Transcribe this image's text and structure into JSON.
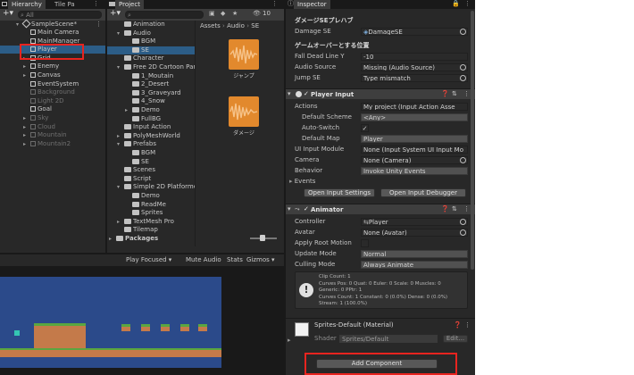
{
  "hierarchy": {
    "tab": "Hierarchy",
    "tab2": "Tile Pa",
    "search_placeholder": "All",
    "scene": "SampleScene*",
    "items": [
      {
        "label": "Main Camera",
        "dim": false,
        "arrow": ""
      },
      {
        "label": "MainManager",
        "dim": false,
        "arrow": ""
      },
      {
        "label": "Player",
        "dim": false,
        "arrow": "",
        "selected": true
      },
      {
        "label": "Grid",
        "dim": false,
        "arrow": "▸"
      },
      {
        "label": "Enemy",
        "dim": false,
        "arrow": "▸"
      },
      {
        "label": "Canvas",
        "dim": false,
        "arrow": "▸"
      },
      {
        "label": "EventSystem",
        "dim": false,
        "arrow": ""
      },
      {
        "label": "Background",
        "dim": true,
        "arrow": ""
      },
      {
        "label": "Light 2D",
        "dim": true,
        "arrow": ""
      },
      {
        "label": "Goal",
        "dim": false,
        "arrow": ""
      },
      {
        "label": "Sky",
        "dim": true,
        "arrow": "▸"
      },
      {
        "label": "Cloud",
        "dim": true,
        "arrow": "▸"
      },
      {
        "label": "Mountain",
        "dim": true,
        "arrow": "▸"
      },
      {
        "label": "Mountain2",
        "dim": true,
        "arrow": "▸"
      }
    ]
  },
  "project": {
    "tab": "Project",
    "badge": "10",
    "breadcrumb": {
      "a": "Assets",
      "b": "Audio",
      "c": "SE"
    },
    "tree": [
      {
        "label": "Animation",
        "indent": 1,
        "arrow": ""
      },
      {
        "label": "Audio",
        "indent": 1,
        "arrow": "▾"
      },
      {
        "label": "BGM",
        "indent": 2,
        "arrow": ""
      },
      {
        "label": "SE",
        "indent": 2,
        "arrow": "",
        "selected": true
      },
      {
        "label": "Character",
        "indent": 1,
        "arrow": ""
      },
      {
        "label": "Free 2D Cartoon Para",
        "indent": 1,
        "arrow": "▾"
      },
      {
        "label": "1_Moutain",
        "indent": 2,
        "arrow": ""
      },
      {
        "label": "2_Desert",
        "indent": 2,
        "arrow": ""
      },
      {
        "label": "3_Graveyard",
        "indent": 2,
        "arrow": ""
      },
      {
        "label": "4_Snow",
        "indent": 2,
        "arrow": ""
      },
      {
        "label": "Demo",
        "indent": 2,
        "arrow": "▸"
      },
      {
        "label": "FullBG",
        "indent": 2,
        "arrow": ""
      },
      {
        "label": "Input Action",
        "indent": 1,
        "arrow": ""
      },
      {
        "label": "PolyMeshWorld",
        "indent": 1,
        "arrow": "▸"
      },
      {
        "label": "Prefabs",
        "indent": 1,
        "arrow": "▾"
      },
      {
        "label": "BGM",
        "indent": 2,
        "arrow": ""
      },
      {
        "label": "SE",
        "indent": 2,
        "arrow": ""
      },
      {
        "label": "Scenes",
        "indent": 1,
        "arrow": ""
      },
      {
        "label": "Script",
        "indent": 1,
        "arrow": ""
      },
      {
        "label": "Simple 2D Platformer",
        "indent": 1,
        "arrow": "▾"
      },
      {
        "label": "Demo",
        "indent": 2,
        "arrow": ""
      },
      {
        "label": "ReadMe",
        "indent": 2,
        "arrow": ""
      },
      {
        "label": "Sprites",
        "indent": 2,
        "arrow": ""
      },
      {
        "label": "TextMesh Pro",
        "indent": 1,
        "arrow": "▸"
      },
      {
        "label": "Tilemap",
        "indent": 1,
        "arrow": ""
      },
      {
        "label": "Packages",
        "indent": 0,
        "arrow": "▸",
        "bold": true
      }
    ],
    "assets": [
      {
        "label": "ジャンプ"
      },
      {
        "label": "ダメージ"
      }
    ]
  },
  "game": {
    "play_focused": "Play Focused",
    "mute": "Mute Audio",
    "stats": "Stats",
    "gizmos": "Gizmos"
  },
  "inspector": {
    "tab": "Inspector",
    "damage_header": "ダメージSEプレハブ",
    "damage_se_label": "Damage SE",
    "damage_se_value": "DamageSE",
    "gameover_header": "ゲームオーバーとする位置",
    "fall_label": "Fall Dead Line Y",
    "fall_value": "-10",
    "audio_source_label": "Audio Source",
    "audio_source_value": "Missing (Audio Source)",
    "jump_se_label": "Jump SE",
    "jump_se_value": "Type mismatch",
    "player_input": {
      "title": "Player Input",
      "actions_label": "Actions",
      "actions_value": "My project (Input Action Asse",
      "default_scheme_label": "Default Scheme",
      "default_scheme_value": "<Any>",
      "auto_switch_label": "Auto-Switch",
      "auto_switch_value": "✓",
      "default_map_label": "Default Map",
      "default_map_value": "Player",
      "ui_module_label": "UI Input Module",
      "ui_module_value": "None (Input System UI Input Mo",
      "camera_label": "Camera",
      "camera_value": "None (Camera)",
      "behavior_label": "Behavior",
      "behavior_value": "Invoke Unity Events",
      "events_label": "Events",
      "open_settings": "Open Input Settings",
      "open_debugger": "Open Input Debugger"
    },
    "animator": {
      "title": "Animator",
      "controller_label": "Controller",
      "controller_value": "Player",
      "avatar_label": "Avatar",
      "avatar_value": "None (Avatar)",
      "root_motion_label": "Apply Root Motion",
      "update_mode_label": "Update Mode",
      "update_mode_value": "Normal",
      "culling_label": "Culling Mode",
      "culling_value": "Always Animate",
      "info_lines": [
        "Clip Count: 1",
        "Curves Pos: 0 Quat: 0 Euler: 0 Scale: 0 Muscles: 0",
        "Generic: 0 PPtr: 1",
        "Curves Count: 1 Constant: 0 (0.0%) Dense: 0 (0.0%)",
        "Stream: 1 (100.0%)"
      ]
    },
    "material": {
      "title": "Sprites-Default (Material)",
      "shader_label": "Shader",
      "shader_value": "Sprites/Default",
      "edit": "Edit..."
    },
    "add_component": "Add Component"
  },
  "colors": {
    "highlight": "#e8241f",
    "selected": "#2c5d87",
    "game_sky": "#2b4a8a",
    "ground": "#c47a4a"
  }
}
